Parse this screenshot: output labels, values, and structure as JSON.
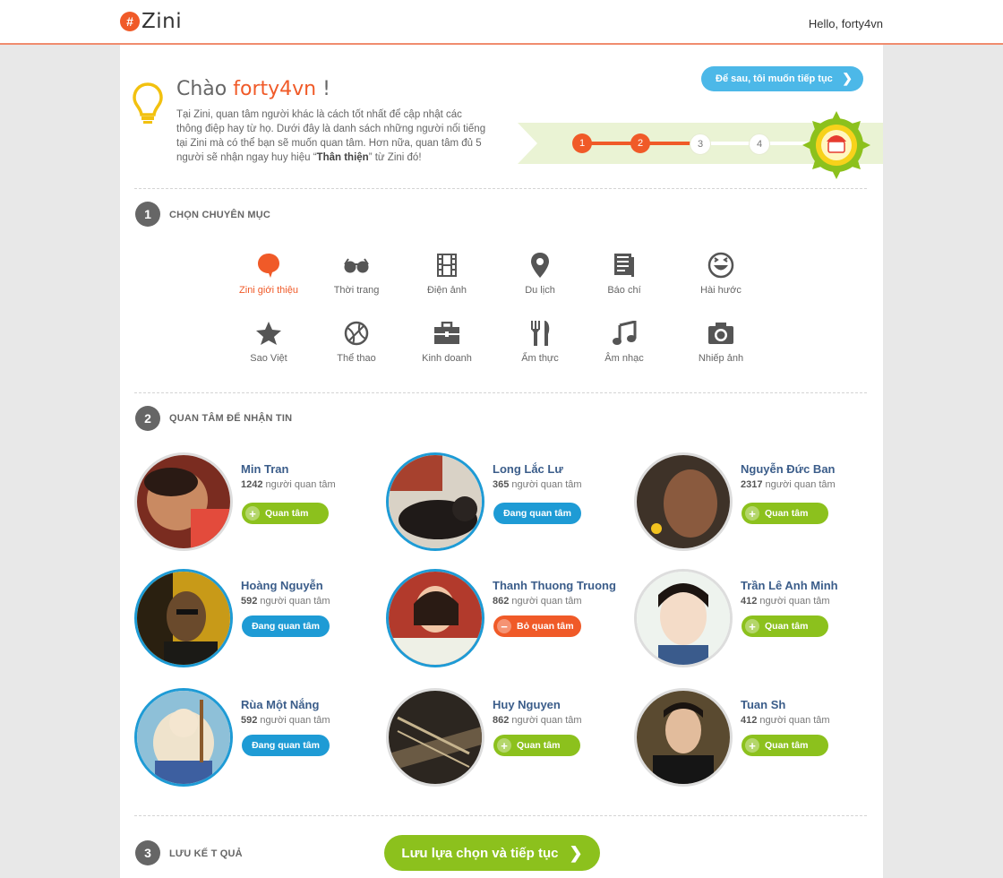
{
  "app": {
    "logo_text": "Zini",
    "hello": "Hello, forty4vn"
  },
  "greeting": {
    "prefix": "Chào",
    "user": "forty4vn",
    "suffix": "!",
    "intro_before": "Tại Zini, quan tâm người khác là cách tốt nhất để cập nhật các thông điệp hay từ họ. Dưới đây là danh sách những người nổi tiếng tại Zini mà có thể  bạn sẽ muốn quan tâm. Hơn nữa, quan tâm đủ 5 người sẽ nhận ngay huy hiệu “",
    "intro_bold": "Thân thiện",
    "intro_after": "” từ Zini đó!",
    "skip_label": "Để sau, tôi muốn tiếp tục"
  },
  "progress": {
    "steps": [
      "1",
      "2",
      "3",
      "4"
    ],
    "completed": 2
  },
  "sections": {
    "s1_num": "1",
    "s1_title": "CHỌN CHUYÊN MỤC",
    "s2_num": "2",
    "s2_title": "QUAN TÂM ĐỂ NHẬN TIN",
    "s3_num": "3",
    "s3_title": "LƯU KẾ T QUẢ"
  },
  "categories": [
    {
      "label": "Zini giới thiệu",
      "icon": "zini-bubble-icon",
      "active": true
    },
    {
      "label": "Thời trang",
      "icon": "sunglasses-icon"
    },
    {
      "label": "Điện ảnh",
      "icon": "film-icon"
    },
    {
      "label": "Du lịch",
      "icon": "map-pin-icon"
    },
    {
      "label": "Báo chí",
      "icon": "newspaper-icon"
    },
    {
      "label": "Hài hước",
      "icon": "laughing-face-icon"
    },
    {
      "label": "Sao Việt",
      "icon": "star-icon"
    },
    {
      "label": "Thể thao",
      "icon": "basketball-icon"
    },
    {
      "label": "Kinh doanh",
      "icon": "briefcase-icon"
    },
    {
      "label": "Ẩm thực",
      "icon": "fork-knife-icon"
    },
    {
      "label": "Âm nhạc",
      "icon": "music-note-icon"
    },
    {
      "label": "Nhiếp ảnh",
      "icon": "camera-icon"
    }
  ],
  "people": [
    {
      "name": "Min Tran",
      "count": "1242",
      "count_suffix": " người quan tâm",
      "button": "Quan tâm",
      "state": "follow"
    },
    {
      "name": "Long Lắc Lư",
      "count": "365",
      "count_suffix": " người quan tâm",
      "button": "Đang quan tâm",
      "state": "following"
    },
    {
      "name": "Nguyễn Đức Ban",
      "count": "2317",
      "count_suffix": " người quan tâm",
      "button": "Quan tâm",
      "state": "follow"
    },
    {
      "name": "Hoàng Nguyễn",
      "count": "592",
      "count_suffix": " người quan tâm",
      "button": "Đang quan tâm",
      "state": "following"
    },
    {
      "name": "Thanh Thuong Truong",
      "count": "862",
      "count_suffix": " người quan tâm",
      "button": "Bỏ quan tâm",
      "state": "unfollow"
    },
    {
      "name": "Trần Lê Anh Minh",
      "count": "412",
      "count_suffix": " người quan tâm",
      "button": "Quan tâm",
      "state": "follow"
    },
    {
      "name": "Rùa Một Nắng",
      "count": "592",
      "count_suffix": " người quan tâm",
      "button": "Đang quan tâm",
      "state": "following"
    },
    {
      "name": "Huy Nguyen",
      "count": "862",
      "count_suffix": " người quan tâm",
      "button": "Quan tâm",
      "state": "follow"
    },
    {
      "name": "Tuan Sh",
      "count": "412",
      "count_suffix": " người quan tâm",
      "button": "Quan tâm",
      "state": "follow"
    }
  ],
  "save_label": "Lưu lựa chọn và tiếp tục",
  "colors": {
    "brand": "#f05a28",
    "follow": "#8cc11d",
    "following": "#1e9bd5",
    "unfollow": "#f05a28",
    "skip": "#4cb8e8",
    "name": "#3b5d8a"
  }
}
